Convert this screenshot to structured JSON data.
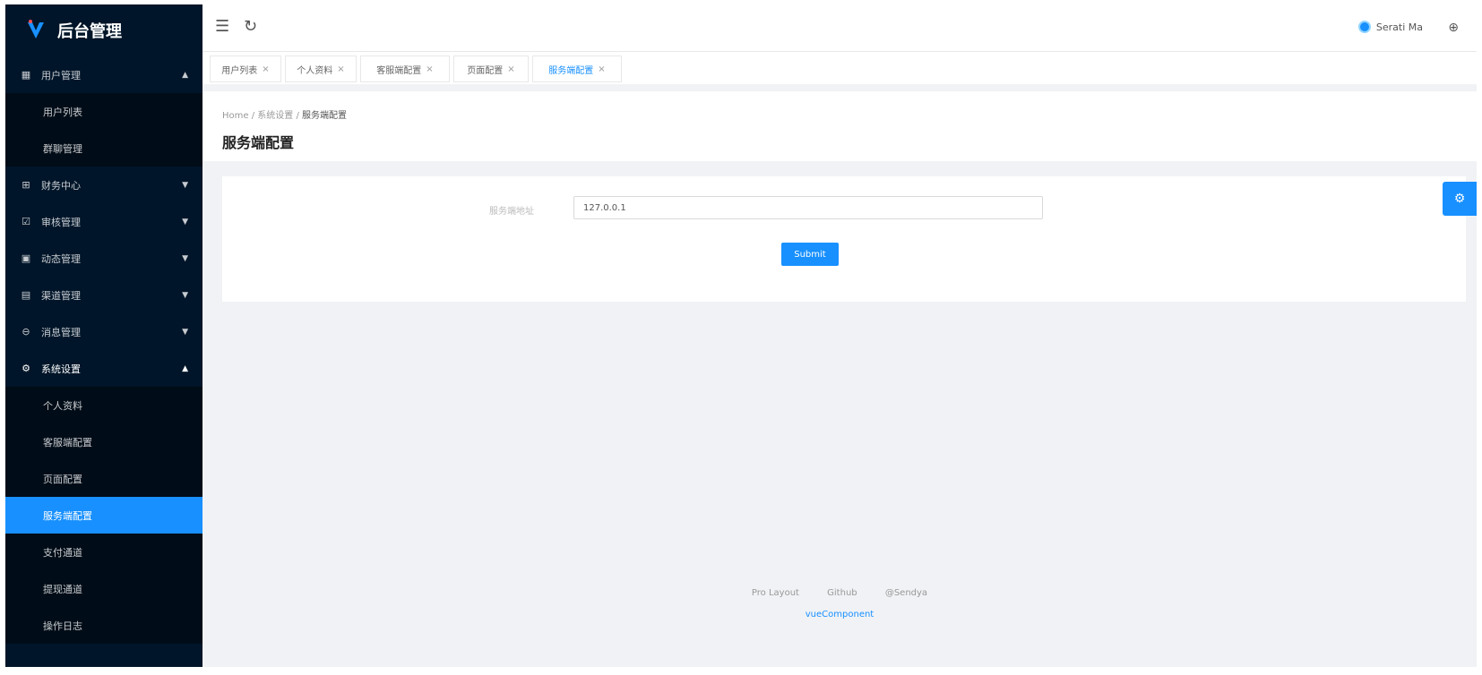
{
  "app": {
    "logo_text": "后台管理"
  },
  "sidebar": {
    "groups": [
      {
        "label": "用户管理",
        "icon": "table-icon",
        "expanded": true,
        "items": [
          "用户列表",
          "群聊管理"
        ]
      },
      {
        "label": "财务中心",
        "icon": "finance-icon",
        "expanded": false
      },
      {
        "label": "审核管理",
        "icon": "audit-icon",
        "expanded": false
      },
      {
        "label": "动态管理",
        "icon": "feed-icon",
        "expanded": false
      },
      {
        "label": "渠道管理",
        "icon": "channel-icon",
        "expanded": false
      },
      {
        "label": "消息管理",
        "icon": "message-icon",
        "expanded": false
      },
      {
        "label": "系统设置",
        "icon": "gear-icon",
        "expanded": true,
        "items": [
          "个人资料",
          "客服端配置",
          "页面配置",
          "服务端配置",
          "支付通道",
          "提现通道",
          "操作日志"
        ]
      }
    ],
    "active_item": "服务端配置"
  },
  "header": {
    "user_name": "Serati Ma"
  },
  "tabs": [
    {
      "label": "用户列表",
      "active": false
    },
    {
      "label": "个人资料",
      "active": false
    },
    {
      "label": "客服端配置",
      "active": false
    },
    {
      "label": "页面配置",
      "active": false
    },
    {
      "label": "服务端配置",
      "active": true
    }
  ],
  "page": {
    "breadcrumb": [
      "Home",
      "系统设置",
      "服务端配置"
    ],
    "title": "服务端配置"
  },
  "form": {
    "field_label": "服务端地址",
    "field_value": "127.0.0.1",
    "submit_label": "Submit"
  },
  "footer": {
    "links": [
      "Pro Layout",
      "Github",
      "@Sendya"
    ],
    "copyright": "vueComponent"
  },
  "colors": {
    "sidebar_bg": "#001529",
    "accent": "#1890ff"
  }
}
